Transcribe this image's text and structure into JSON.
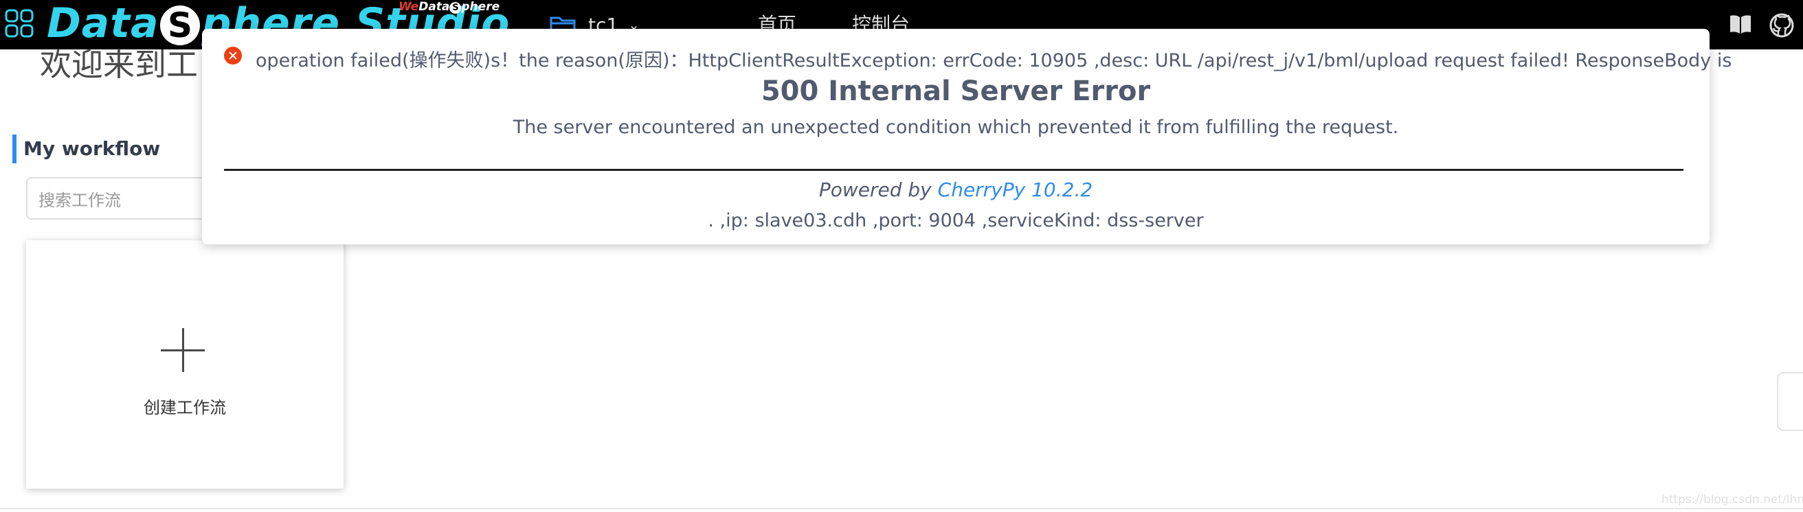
{
  "header": {
    "logo_prefix": "Data",
    "logo_s": "S",
    "logo_suffix": "phere Studio",
    "sublogo_we": "We",
    "sublogo_data": "Data",
    "sublogo_s": "S",
    "sublogo_rest": "phere",
    "project_name": "tc1",
    "nav_home": "首页",
    "nav_console": "控制台",
    "icons": [
      "apps-grid-icon",
      "folder-icon",
      "chevron-down-icon",
      "book-icon",
      "github-icon"
    ]
  },
  "main": {
    "welcome": "欢迎来到工",
    "section_title": "My workflow",
    "search_placeholder": "搜索工作流",
    "create_label": "创建工作流"
  },
  "error": {
    "line1": "operation failed(操作失败)s！the reason(原因)：HttpClientResultException: errCode: 10905 ,desc: URL /api/rest_j/v1/bml/upload request failed! ResponseBody is",
    "heading": "500 Internal Server Error",
    "description": "The server encountered an unexpected condition which prevented it from fulfilling the request.",
    "powered_prefix": "Powered by",
    "powered_link": "CherryPy 10.2.2",
    "ip_line": ". ,ip: slave03.cdh ,port: 9004 ,serviceKind: dss-server"
  },
  "watermark": "https://blog.csdn.net/lhmoo",
  "colors": {
    "topbar": "#000000",
    "logo_cyan": "#34d4ee",
    "accent": "#2d8cf0",
    "error_red": "#ed4014"
  }
}
